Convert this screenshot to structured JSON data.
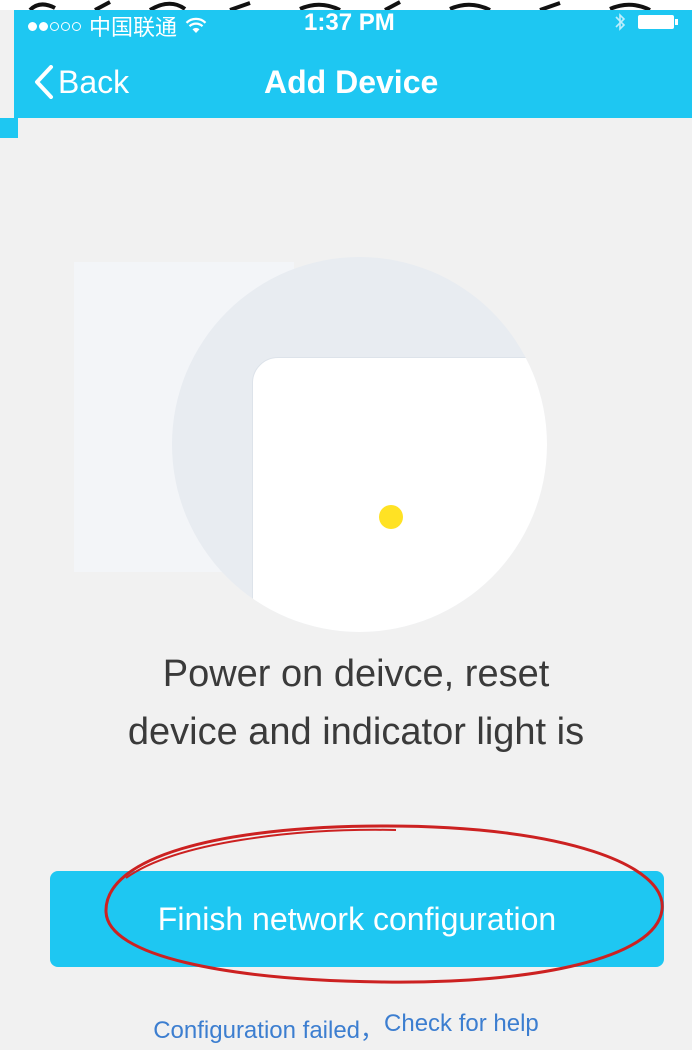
{
  "status_bar": {
    "carrier": "中国联通",
    "time": "1:37 PM",
    "signal_bars": 2,
    "signal_total": 5,
    "icons": [
      "wifi-icon",
      "bluetooth-icon",
      "battery-icon"
    ]
  },
  "nav": {
    "back_label": "Back",
    "title": "Add Device"
  },
  "illustration": {
    "indicator_color": "#ffe224"
  },
  "instruction": {
    "line1": "Power on deivce, reset",
    "line2": "device and indicator light is"
  },
  "finish_button": {
    "label": "Finish network configuration"
  },
  "help": {
    "failed_text": "Configuration failed，",
    "help_text": "Check for help"
  },
  "colors": {
    "accent": "#1ec7f2",
    "link": "#3c7ed0",
    "annotation": "#cc2121"
  }
}
